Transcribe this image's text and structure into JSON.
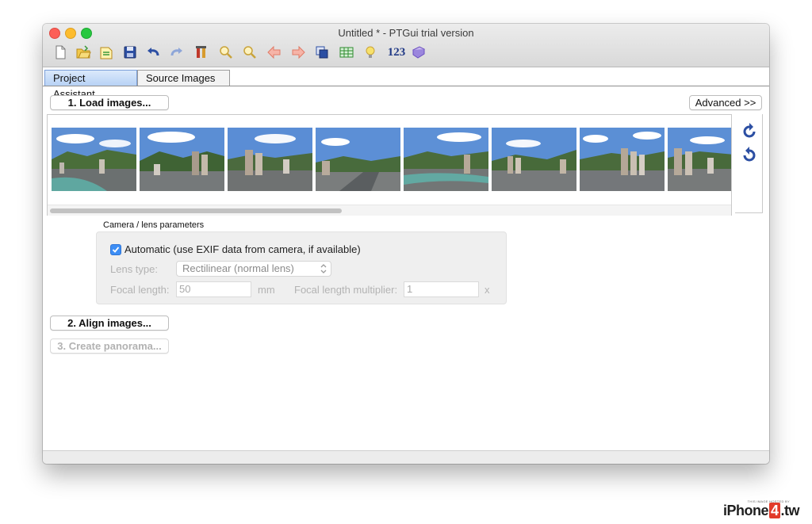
{
  "window": {
    "title": "Untitled * - PTGui trial version"
  },
  "toolbar": {
    "icons": [
      "new-document-icon",
      "open-folder-icon",
      "open-project-icon",
      "save-icon",
      "undo-icon",
      "redo-icon",
      "tools-icon",
      "zoom-in-icon",
      "zoom-out-icon",
      "arrow-left-icon",
      "arrow-right-icon",
      "copy-layers-icon",
      "table-icon",
      "lightbulb-icon",
      "numbers-icon",
      "help-book-icon"
    ],
    "numbers_label": "123"
  },
  "tabs": [
    {
      "label": "Project Assistant",
      "active": true
    },
    {
      "label": "Source Images",
      "active": false
    }
  ],
  "buttons": {
    "load_images": "1. Load images...",
    "advanced": "Advanced >>",
    "align_images": "2. Align images...",
    "create_panorama": "3. Create panorama..."
  },
  "thumbnails": {
    "count": 8
  },
  "camera": {
    "group_title": "Camera / lens parameters",
    "automatic_label": "Automatic (use EXIF data from camera, if available)",
    "automatic_checked": true,
    "lens_type_label": "Lens type:",
    "lens_type_value": "Rectilinear (normal lens)",
    "focal_length_label": "Focal length:",
    "focal_length_value": "50",
    "focal_length_unit": "mm",
    "multiplier_label": "Focal length multiplier:",
    "multiplier_value": "1",
    "multiplier_unit": "x"
  },
  "watermark": {
    "small_text": "THIS IMAGE HOSTED BY",
    "brand_prefix": "iPhone",
    "brand_number": "4",
    "brand_suffix": ".tw"
  },
  "colors": {
    "accent": "#3d8ef5",
    "tab_active": "#b7d2f5",
    "brand_red": "#e23b2a"
  }
}
